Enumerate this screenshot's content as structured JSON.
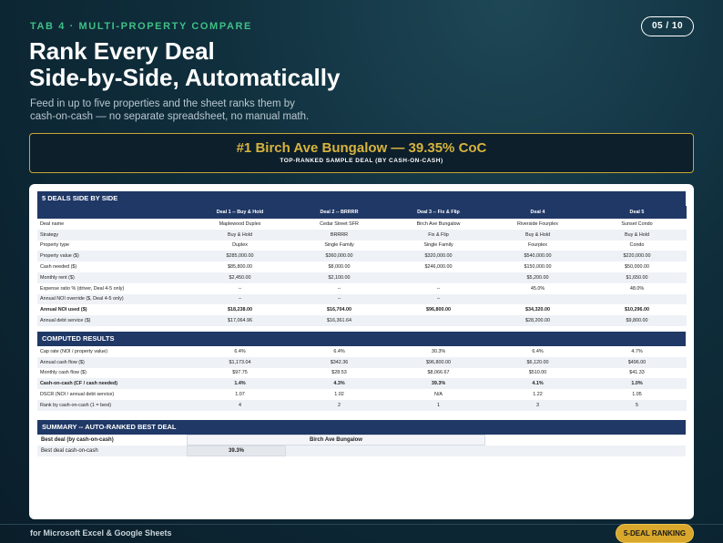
{
  "tag": "TAB 4 · MULTI-PROPERTY COMPARE",
  "page": "05 / 10",
  "title_line1": "Rank Every Deal",
  "title_line2": "Side-by-Side, Automatically",
  "subtitle_line1": "Feed in up to five properties and the sheet ranks them by",
  "subtitle_line2": "cash-on-cash — no separate spreadsheet, no manual math.",
  "hero": {
    "main": "#1 Birch Ave Bungalow — 39.35% CoC",
    "sub": "TOP-RANKED SAMPLE DEAL (BY CASH-ON-CASH)"
  },
  "sections": {
    "deals": "5 DEALS SIDE BY SIDE",
    "computed": "COMPUTED RESULTS",
    "summary": "SUMMARY -- AUTO-RANKED BEST DEAL"
  },
  "headers": [
    "",
    "Deal 1 -- Buy & Hold",
    "Deal 2 -- BRRRR",
    "Deal 3 -- Fix & Flip",
    "Deal 4",
    "Deal 5"
  ],
  "deal_rows": [
    {
      "label": "Deal name",
      "v": [
        "Maplewood Duplex",
        "Cedar Street SFR",
        "Birch Ave Bungalow",
        "Riverside Fourplex",
        "Sunset Condo"
      ]
    },
    {
      "label": "Strategy",
      "v": [
        "Buy & Hold",
        "BRRRR",
        "Fix & Flip",
        "Buy & Hold",
        "Buy & Hold"
      ]
    },
    {
      "label": "Property type",
      "v": [
        "Duplex",
        "Single Family",
        "Single Family",
        "Fourplex",
        "Condo"
      ]
    },
    {
      "label": "Property value ($)",
      "v": [
        "$285,000.00",
        "$360,000.00",
        "$320,000.00",
        "$540,000.00",
        "$220,000.00"
      ]
    },
    {
      "label": "Cash needed ($)",
      "v": [
        "$85,800.00",
        "$8,000.00",
        "$246,000.00",
        "$150,000.00",
        "$50,000.00"
      ]
    },
    {
      "label": "Monthly rent ($)",
      "v": [
        "$2,450.00",
        "$2,100.00",
        "",
        "$5,200.00",
        "$1,650.00"
      ]
    },
    {
      "label": "Expense ratio % (driver, Deal 4-5 only)",
      "v": [
        "--",
        "--",
        "--",
        "45.0%",
        "48.0%"
      ]
    },
    {
      "label": "Annual NOI override ($, Deal 4-5 only)",
      "v": [
        "--",
        "--",
        "--",
        "",
        ""
      ]
    },
    {
      "label": "Annual NOI used ($)",
      "v": [
        "$18,238.00",
        "$16,704.00",
        "$96,800.00",
        "$34,320.00",
        "$10,296.00"
      ],
      "bold": true
    },
    {
      "label": "Annual debt service ($)",
      "v": [
        "$17,064.96",
        "$16,361.64",
        "",
        "$28,200.00",
        "$9,800.00"
      ]
    }
  ],
  "computed_rows": [
    {
      "label": "Cap rate (NOI / property value)",
      "v": [
        "6.4%",
        "6.4%",
        "30.3%",
        "6.4%",
        "4.7%"
      ]
    },
    {
      "label": "Annual cash flow ($)",
      "v": [
        "$1,173.04",
        "$342.36",
        "$96,800.00",
        "$6,120.00",
        "$496.00"
      ]
    },
    {
      "label": "Monthly cash flow ($)",
      "v": [
        "$97.75",
        "$28.53",
        "$8,066.67",
        "$510.00",
        "$41.33"
      ]
    },
    {
      "label": "Cash-on-cash (CF / cash needed)",
      "v": [
        "1.4%",
        "4.3%",
        "39.3%",
        "4.1%",
        "1.0%"
      ],
      "bold": true
    },
    {
      "label": "DSCR (NOI / annual debt service)",
      "v": [
        "1.07",
        "1.02",
        "N/A",
        "1.22",
        "1.05"
      ]
    },
    {
      "label": "Rank by cash-on-cash (1 = best)",
      "v": [
        "4",
        "2",
        "1",
        "3",
        "5"
      ]
    }
  ],
  "summary": {
    "best_label": "Best deal (by cash-on-cash)",
    "best_value": "Birch Ave Bungalow",
    "coc_label": "Best deal cash-on-cash",
    "coc_value": "39.3%"
  },
  "footer": {
    "text": "for Microsoft Excel & Google Sheets",
    "badge": "5-DEAL RANKING"
  },
  "colors": {
    "accent_green": "#3fbf86",
    "gold": "#d8b33e",
    "navy": "#1f3866"
  }
}
